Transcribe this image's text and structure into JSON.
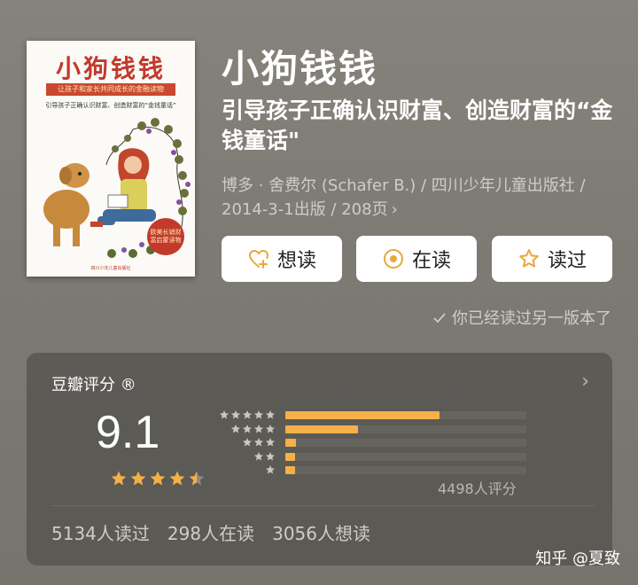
{
  "book": {
    "cover": {
      "title": "小狗钱钱",
      "banner": "让孩子和家长共同成长的金融读物",
      "sub": "引导孩子正确认识财富、创造财富的“金钱童话”",
      "stamp": "欧美长销财富启蒙读物",
      "publisher": "四川少年儿童出版社"
    },
    "title": "小狗钱钱",
    "subtitle": "引导孩子正确认识财富、创造财富的“金钱童话\"",
    "meta": "博多 · 舍费尔 (Schafer B.) / 四川少年儿童出版社 / 2014-3-1出版 / 208页",
    "meta_chevron": "›"
  },
  "actions": {
    "want": "想读",
    "reading": "在读",
    "read": "读过"
  },
  "note": "你已经读过另一版本了",
  "rating": {
    "title": "豆瓣评分 ®",
    "chevron": "›",
    "score": "9.1",
    "stars": 4.5,
    "distribution": [
      {
        "stars": 5,
        "fraction": 0.64
      },
      {
        "stars": 4,
        "fraction": 0.3
      },
      {
        "stars": 3,
        "fraction": 0.045
      },
      {
        "stars": 2,
        "fraction": 0.04
      },
      {
        "stars": 1,
        "fraction": 0.04
      }
    ],
    "count": "4498人评分"
  },
  "stats": {
    "read": "5134人读过",
    "reading": "298人在读",
    "want": "3056人想读"
  },
  "watermark": "知乎 @夏致",
  "colors": {
    "accent": "#f5b04a",
    "cover_red": "#c23a2c",
    "want_icon": "#e8a83b",
    "reading_icon": "#e8a83b"
  }
}
